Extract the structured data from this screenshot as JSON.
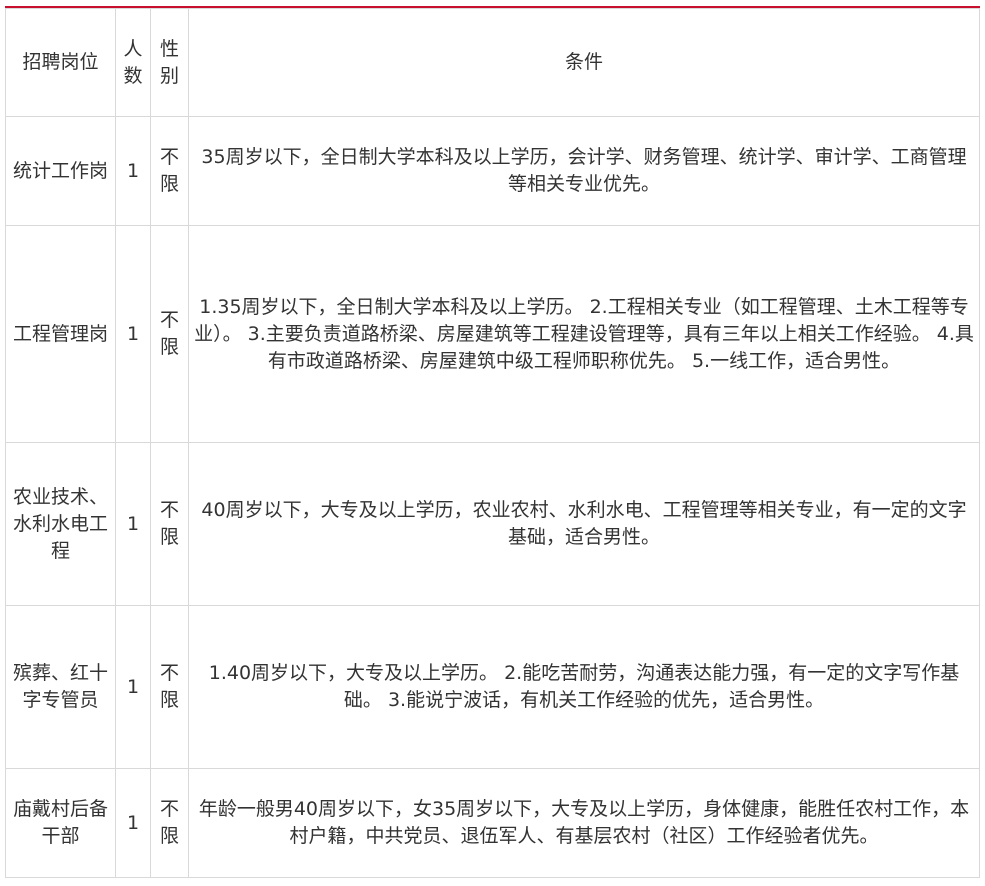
{
  "header": {
    "position": "招聘岗位",
    "count": "人数",
    "gender": "性别",
    "conditions": "条件"
  },
  "rows": [
    {
      "position": "统计工作岗",
      "count": "1",
      "gender": "不限",
      "conditions": "35周岁以下，全日制大学本科及以上学历，会计学、财务管理、统计学、审计学、工商管理等相关专业优先。"
    },
    {
      "position": "工程管理岗",
      "count": "1",
      "gender": "不限",
      "conditions": "1.35周岁以下，全日制大学本科及以上学历。 2.工程相关专业（如工程管理、土木工程等专业）。 3.主要负责道路桥梁、房屋建筑等工程建设管理等，具有三年以上相关工作经验。 4.具有市政道路桥梁、房屋建筑中级工程师职称优先。 5.一线工作，适合男性。"
    },
    {
      "position": "农业技术、水利水电工程",
      "count": "1",
      "gender": "不限",
      "conditions": "40周岁以下，大专及以上学历，农业农村、水利水电、工程管理等相关专业，有一定的文字基础，适合男性。"
    },
    {
      "position": "殡葬、红十字专管员",
      "count": "1",
      "gender": "不限",
      "conditions": "1.40周岁以下，大专及以上学历。 2.能吃苦耐劳，沟通表达能力强，有一定的文字写作基础。 3.能说宁波话，有机关工作经验的优先，适合男性。"
    },
    {
      "position": "庙戴村后备干部",
      "count": "1",
      "gender": "不限",
      "conditions": "年龄一般男40周岁以下，女35周岁以下，大专及以上学历，身体健康，能胜任农村工作，本村户籍，中共党员、退伍军人、有基层农村（社区）工作经验者优先。"
    }
  ]
}
